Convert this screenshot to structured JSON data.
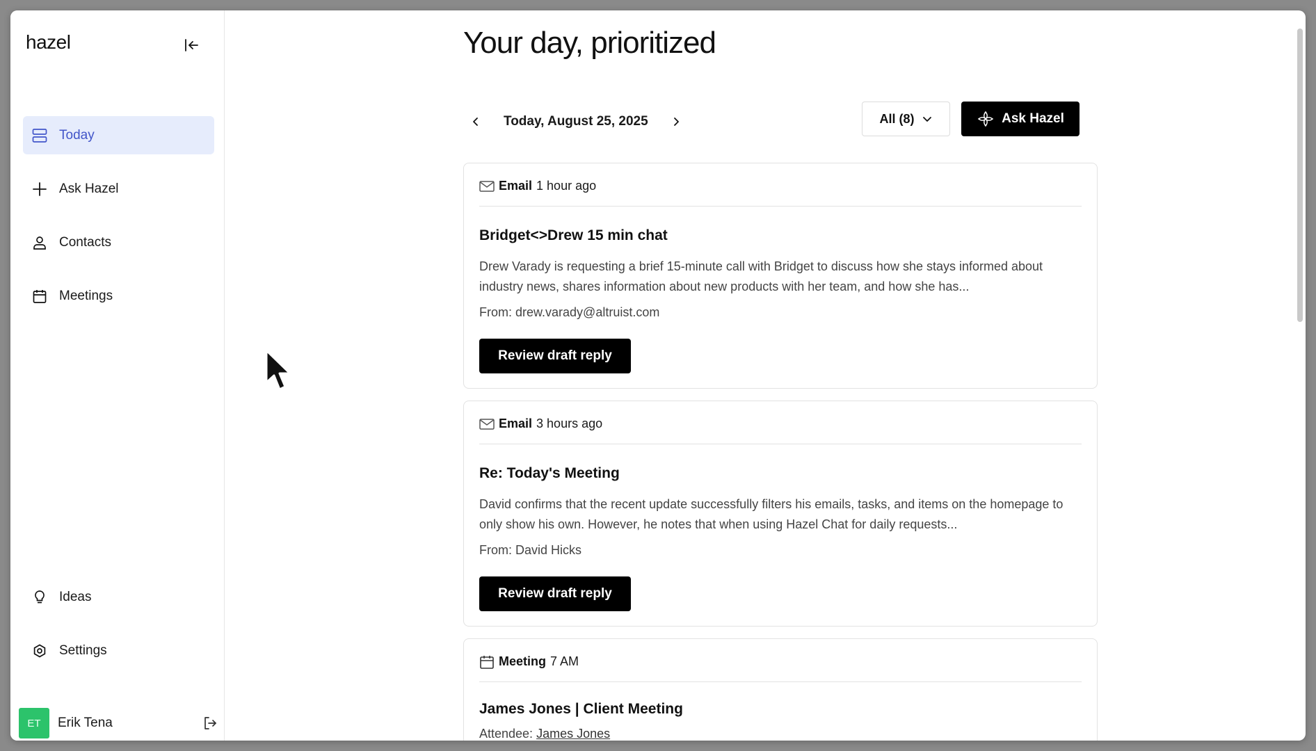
{
  "app": {
    "logo": "hazel"
  },
  "sidebar": {
    "items": [
      {
        "label": "Today",
        "icon": "today-icon",
        "active": true
      },
      {
        "label": "Ask Hazel",
        "icon": "plus-icon"
      },
      {
        "label": "Contacts",
        "icon": "person-icon"
      },
      {
        "label": "Meetings",
        "icon": "calendar-icon"
      }
    ],
    "bottom_items": [
      {
        "label": "Ideas",
        "icon": "lightbulb-icon"
      },
      {
        "label": "Settings",
        "icon": "settings-icon"
      }
    ],
    "user": {
      "initials": "ET",
      "name": "Erik Tena",
      "avatar_color": "#2cc36b"
    }
  },
  "main": {
    "title": "Your day, prioritized",
    "date": "Today, August 25, 2025",
    "filter_label": "All (8)",
    "ask_button": "Ask Hazel"
  },
  "cards": [
    {
      "type": "Email",
      "time": "1 hour ago",
      "title": "Bridget<>Drew 15 min chat",
      "summary": "Drew Varady is requesting a brief 15-minute call with Bridget to discuss how she stays informed about industry news, shares information about new products with her team, and how she has...",
      "from": "From: drew.varady@altruist.com",
      "action": "Review draft reply"
    },
    {
      "type": "Email",
      "time": "3 hours ago",
      "title": "Re: Today's Meeting",
      "summary": "David confirms that the recent update successfully filters his emails, tasks, and items on the homepage to only show his own. However, he notes that when using Hazel Chat for daily requests...",
      "from": "From: David Hicks",
      "action": "Review draft reply"
    },
    {
      "type": "Meeting",
      "time": "7 AM",
      "title": "James Jones | Client Meeting",
      "attendee_label": "Attendee:",
      "attendee_name": "James Jones"
    }
  ],
  "colors": {
    "accent": "#4255c9",
    "active_bg": "#e6ecfc",
    "primary_button": "#000000"
  }
}
